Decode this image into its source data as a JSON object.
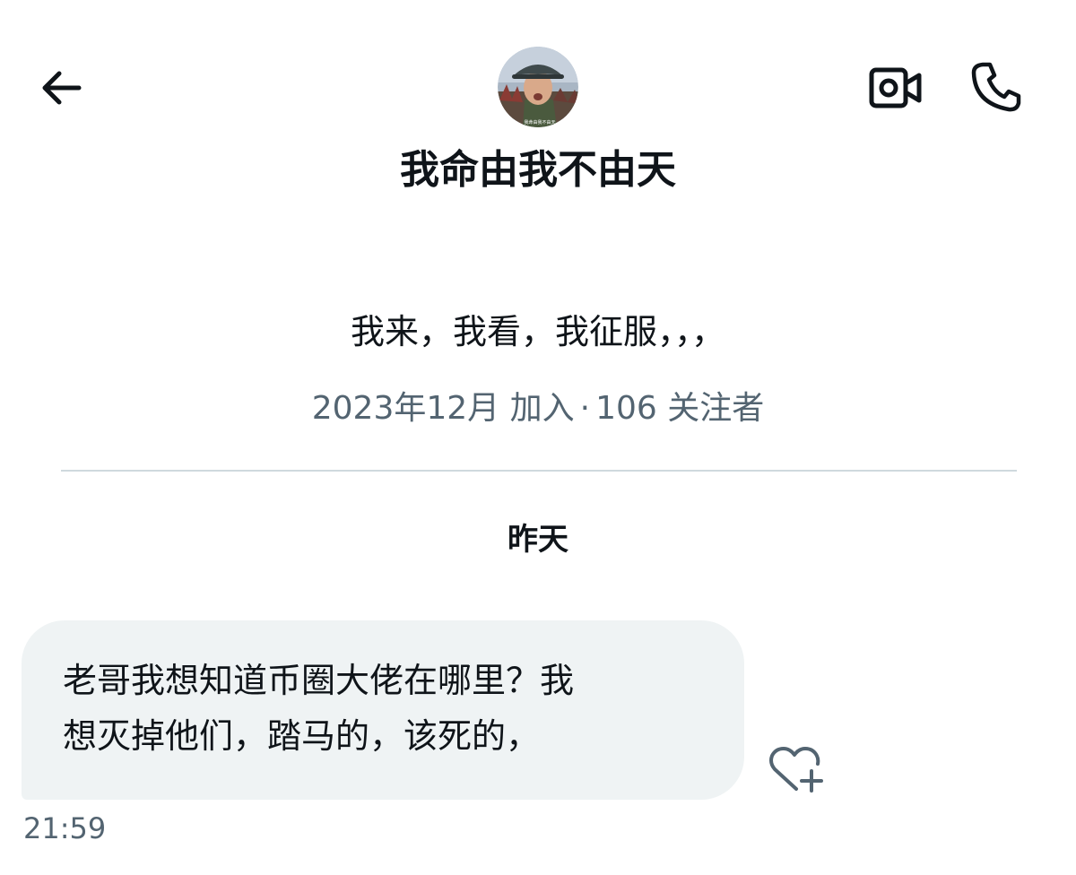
{
  "header": {
    "back_icon": "arrow-left-icon",
    "video_icon": "video-camera-icon",
    "call_icon": "phone-icon",
    "avatar_badge_text": "我命由我不由天"
  },
  "profile": {
    "name": "我命由我不由天",
    "bio": "我来，我看，我征服，，，",
    "joined": "2023年12月 加入",
    "separator": "·",
    "followers": "106 关注者"
  },
  "conversation": {
    "day_label": "昨天",
    "messages": [
      {
        "lines": [
          "老哥我想知道币圈大佬在哪里？我",
          "想灭掉他们，踏马的，该死的，"
        ],
        "time": "21:59",
        "reaction_icon": "heart-plus-icon"
      }
    ]
  },
  "colors": {
    "text_primary": "#0f1419",
    "text_secondary": "#536471",
    "bubble_bg": "#eff3f4",
    "divider": "#cfd9de"
  }
}
